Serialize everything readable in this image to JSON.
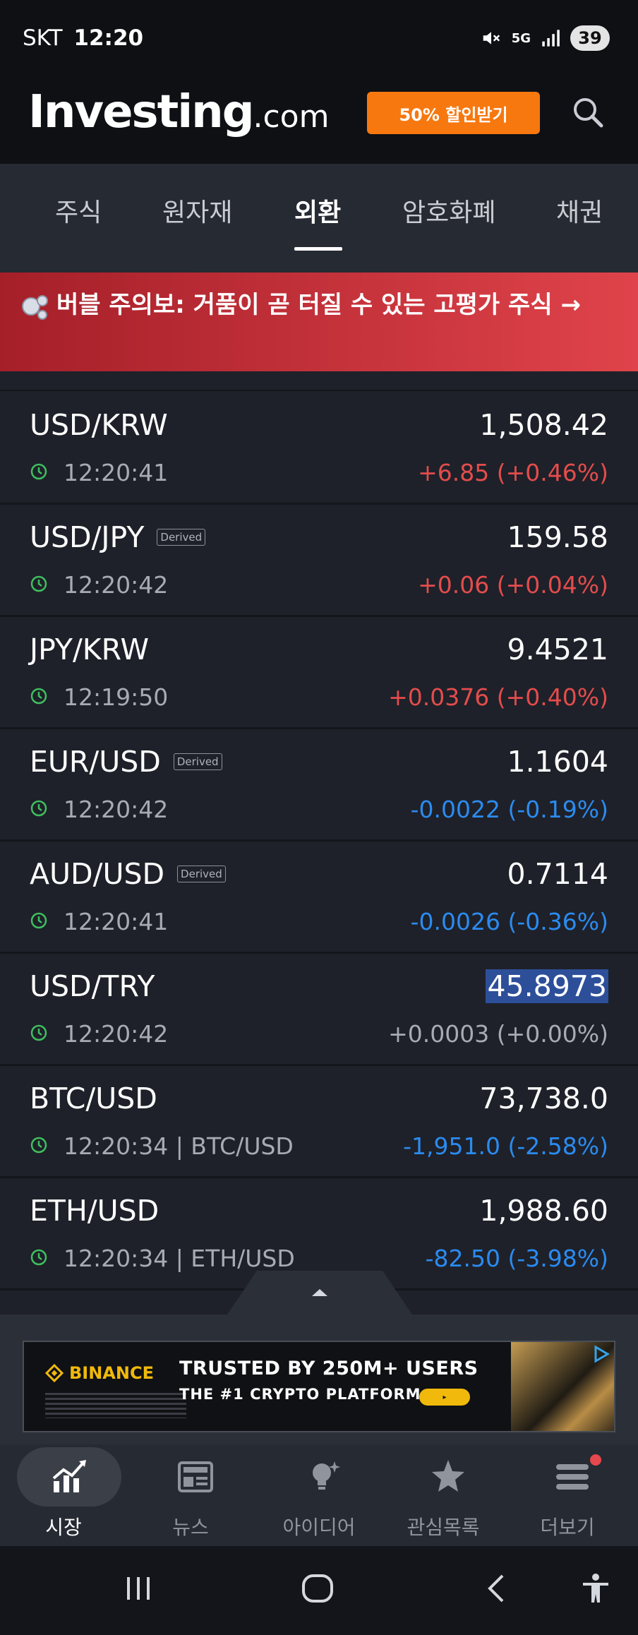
{
  "status_bar": {
    "carrier": "SKT",
    "time": "12:20",
    "network": "5G",
    "battery": "39"
  },
  "header": {
    "logo_main": "Investing",
    "logo_suffix": ".com",
    "promo_label": "50% 할인받기"
  },
  "tabs": [
    {
      "label": "주식",
      "active": false
    },
    {
      "label": "원자재",
      "active": false
    },
    {
      "label": "외환",
      "active": true
    },
    {
      "label": "암호화폐",
      "active": false
    },
    {
      "label": "채권",
      "active": false
    }
  ],
  "alert_banner": {
    "text": "버블 주의보: 거품이 곧 터질 수 있는 고평가 주식 →"
  },
  "quotes": [
    {
      "pair": "USD/KRW",
      "derived": false,
      "time": "12:20:41",
      "price": "1,508.42",
      "change": "+6.85 (+0.46%)",
      "direction": "up"
    },
    {
      "pair": "USD/JPY",
      "derived": true,
      "time": "12:20:42",
      "price": "159.58",
      "change": "+0.06 (+0.04%)",
      "direction": "up"
    },
    {
      "pair": "JPY/KRW",
      "derived": false,
      "time": "12:19:50",
      "price": "9.4521",
      "change": "+0.0376 (+0.40%)",
      "direction": "up"
    },
    {
      "pair": "EUR/USD",
      "derived": true,
      "time": "12:20:42",
      "price": "1.1604",
      "change": "-0.0022 (-0.19%)",
      "direction": "down"
    },
    {
      "pair": "AUD/USD",
      "derived": true,
      "time": "12:20:41",
      "price": "0.7114",
      "change": "-0.0026 (-0.36%)",
      "direction": "down"
    },
    {
      "pair": "USD/TRY",
      "derived": false,
      "time": "12:20:42",
      "price": "45.8973",
      "change": "+0.0003 (+0.00%)",
      "direction": "flat"
    },
    {
      "pair": "BTC/USD",
      "derived": false,
      "time": "12:20:34 | BTC/USD",
      "price": "73,738.0",
      "change": "-1,951.0 (-2.58%)",
      "direction": "down"
    },
    {
      "pair": "ETH/USD",
      "derived": false,
      "time": "12:20:34 | ETH/USD",
      "price": "1,988.60",
      "change": "-82.50 (-3.98%)",
      "direction": "down"
    }
  ],
  "derived_label": "Derived",
  "ad": {
    "brand": "BINANCE",
    "headline": "TRUSTED BY 250M+ USERS",
    "subline": "THE #1 CRYPTO PLATFORM"
  },
  "bottom_nav": [
    {
      "label": "시장",
      "icon": "chart-icon",
      "active": true
    },
    {
      "label": "뉴스",
      "icon": "news-icon",
      "active": false
    },
    {
      "label": "아이디어",
      "icon": "lightbulb-icon",
      "active": false
    },
    {
      "label": "관심목록",
      "icon": "star-icon",
      "active": false
    },
    {
      "label": "더보기",
      "icon": "menu-icon",
      "active": false
    }
  ],
  "colors": {
    "up": "#e44c4c",
    "down": "#2b8bf0",
    "flat": "#a7abb3",
    "promo": "#f7780f"
  }
}
